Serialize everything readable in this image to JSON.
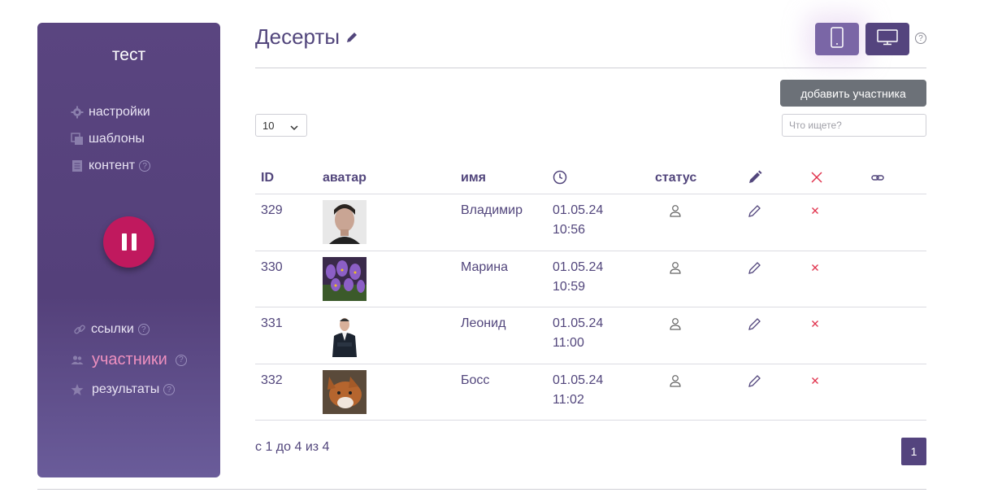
{
  "sidebar": {
    "title": "тест",
    "items": [
      {
        "label": "настройки",
        "icon": "gear-icon"
      },
      {
        "label": "шаблоны",
        "icon": "templates-icon"
      },
      {
        "label": "контент",
        "icon": "document-icon",
        "help": "?"
      },
      {
        "label": "ссылки",
        "icon": "link-icon",
        "help": "?"
      },
      {
        "label": "участники",
        "icon": "users-icon",
        "help": "?",
        "active": true
      },
      {
        "label": "результаты",
        "icon": "star-icon",
        "help": "?"
      }
    ],
    "pause_icon": "pause-icon"
  },
  "header": {
    "title": "Десерты",
    "help": "?",
    "mobile_icon": "mobile-icon",
    "desktop_icon": "desktop-icon"
  },
  "toolbar": {
    "add_label": "добавить участника",
    "page_size": "10",
    "search_placeholder": "Что ищете?"
  },
  "table": {
    "columns": [
      "ID",
      "аватар",
      "имя",
      "clock-icon",
      "статус",
      "pencil-icon",
      "close-icon",
      "link-icon"
    ],
    "rows": [
      {
        "id": "329",
        "name": "Владимир",
        "date": "01.05.24",
        "time": "10:56",
        "avatar": "man-portrait"
      },
      {
        "id": "330",
        "name": "Марина",
        "date": "01.05.24",
        "time": "10:59",
        "avatar": "purple-flowers"
      },
      {
        "id": "331",
        "name": "Леонид",
        "date": "01.05.24",
        "time": "11:00",
        "avatar": "man-in-suit"
      },
      {
        "id": "332",
        "name": "Босс",
        "date": "01.05.24",
        "time": "11:02",
        "avatar": "dog"
      }
    ]
  },
  "footer": {
    "summary": "с 1 до 4 из 4",
    "current_page": "1"
  },
  "colors": {
    "sidebar_bg": "#54407a",
    "accent": "#54447e",
    "pause_button": "#c0195e",
    "active_item": "#ee90bf",
    "delete": "#e0334d"
  }
}
